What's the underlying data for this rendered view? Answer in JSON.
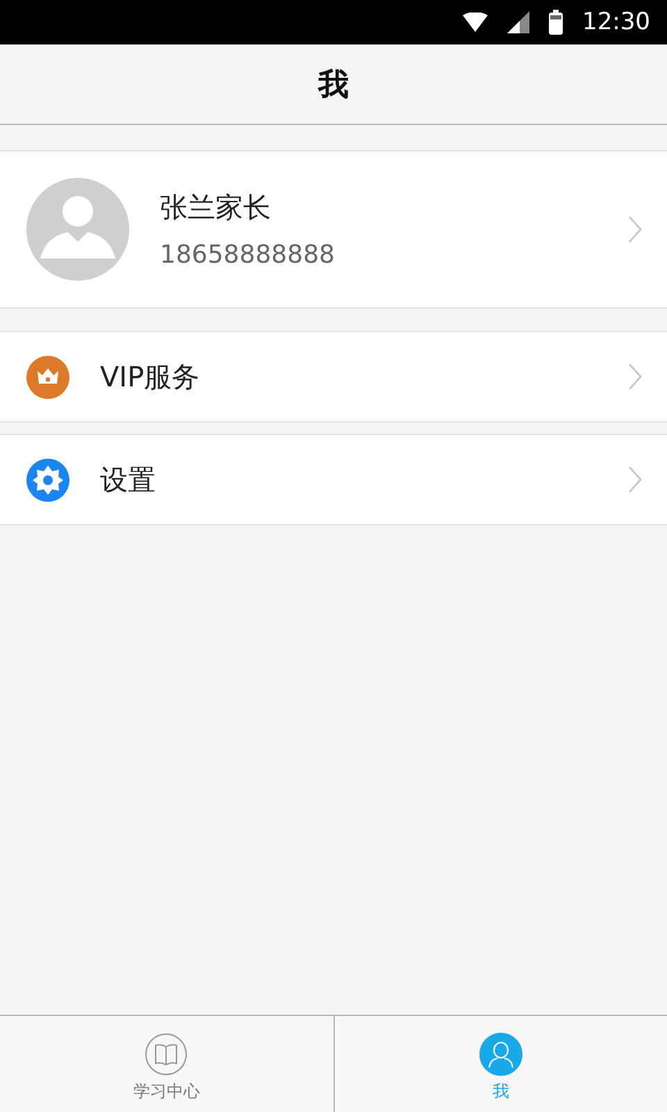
{
  "status_bar": {
    "time": "12:30"
  },
  "header": {
    "title": "我"
  },
  "profile": {
    "name": "张兰家长",
    "phone": "18658888888"
  },
  "menu_groups": [
    [
      {
        "kind": "vip",
        "label": "VIP服务"
      }
    ],
    [
      {
        "kind": "settings",
        "label": "设置"
      }
    ]
  ],
  "tabs": [
    {
      "kind": "study",
      "label": "学习中心",
      "selected": false
    },
    {
      "kind": "me",
      "label": "我",
      "selected": true
    }
  ]
}
